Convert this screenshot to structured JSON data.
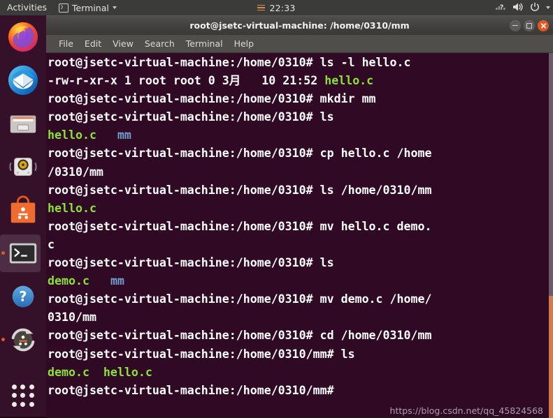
{
  "top_panel": {
    "activities_label": "Activities",
    "app_menu_label": "Terminal",
    "clock": "22:33",
    "indicators": [
      "network-icon",
      "volume-icon",
      "power-icon",
      "chevron-down-icon"
    ]
  },
  "dock": {
    "items": [
      {
        "name": "firefox",
        "label": "Firefox",
        "running": false,
        "active": false
      },
      {
        "name": "thunderbird",
        "label": "Thunderbird Mail",
        "running": false,
        "active": false
      },
      {
        "name": "files",
        "label": "Files",
        "running": false,
        "active": false
      },
      {
        "name": "rhythmbox",
        "label": "Rhythmbox",
        "running": false,
        "active": false
      },
      {
        "name": "ubuntu-software",
        "label": "Ubuntu Software",
        "running": false,
        "active": false
      },
      {
        "name": "terminal",
        "label": "Terminal",
        "running": true,
        "active": true
      },
      {
        "name": "help",
        "label": "Help",
        "running": false,
        "active": false
      },
      {
        "name": "software-updater",
        "label": "Software Updater",
        "running": true,
        "active": false
      }
    ],
    "show_apps_label": "Show Applications"
  },
  "window": {
    "title": "root@jsetc-virtual-machine: /home/0310/mm",
    "buttons": {
      "minimize": "minimize-button",
      "maximize": "maximize-button",
      "close": "close-button"
    },
    "menu": [
      "File",
      "Edit",
      "View",
      "Search",
      "Terminal",
      "Help"
    ]
  },
  "terminal": {
    "background": "#300a24",
    "foreground": "#ffffff",
    "dir_color": "#729fcf",
    "exec_color": "#8ae234",
    "prompt": "root@jsetc-virtual-machine:/home/0310# ",
    "prompt_mm": "root@jsetc-virtual-machine:/home/0310/mm# ",
    "lines": [
      [
        {
          "t": "root@jsetc-virtual-machine:/home/0310# ls -l hello.c",
          "c": "white"
        }
      ],
      [
        {
          "t": "-rw-r-xr-x 1 root root 0 3月   10 21:52 ",
          "c": "white"
        },
        {
          "t": "hello.c",
          "c": "green"
        }
      ],
      [
        {
          "t": "root@jsetc-virtual-machine:/home/0310# mkdir mm",
          "c": "white"
        }
      ],
      [
        {
          "t": "root@jsetc-virtual-machine:/home/0310# ls",
          "c": "white"
        }
      ],
      [
        {
          "t": "hello.c",
          "c": "green"
        },
        {
          "t": "   ",
          "c": "white"
        },
        {
          "t": "mm",
          "c": "blue"
        }
      ],
      [
        {
          "t": "root@jsetc-virtual-machine:/home/0310# cp hello.c /home",
          "c": "white"
        }
      ],
      [
        {
          "t": "/0310/mm",
          "c": "white"
        }
      ],
      [
        {
          "t": "root@jsetc-virtual-machine:/home/0310# ls /home/0310/mm",
          "c": "white"
        }
      ],
      [
        {
          "t": "hello.c",
          "c": "green"
        }
      ],
      [
        {
          "t": "root@jsetc-virtual-machine:/home/0310# mv hello.c demo.",
          "c": "white"
        }
      ],
      [
        {
          "t": "c",
          "c": "white"
        }
      ],
      [
        {
          "t": "root@jsetc-virtual-machine:/home/0310# ls",
          "c": "white"
        }
      ],
      [
        {
          "t": "demo.c",
          "c": "green"
        },
        {
          "t": "   ",
          "c": "white"
        },
        {
          "t": "mm",
          "c": "blue"
        }
      ],
      [
        {
          "t": "root@jsetc-virtual-machine:/home/0310# mv demo.c /home/",
          "c": "white"
        }
      ],
      [
        {
          "t": "0310/mm",
          "c": "white"
        }
      ],
      [
        {
          "t": "root@jsetc-virtual-machine:/home/0310# cd /home/0310/mm",
          "c": "white"
        }
      ],
      [
        {
          "t": "root@jsetc-virtual-machine:/home/0310/mm# ls",
          "c": "white"
        }
      ],
      [
        {
          "t": "demo.c  hello.c",
          "c": "green"
        }
      ],
      [
        {
          "t": "root@jsetc-virtual-machine:/home/0310/mm#",
          "c": "white"
        }
      ]
    ]
  },
  "watermark": "https://blog.csdn.net/qq_45824568"
}
